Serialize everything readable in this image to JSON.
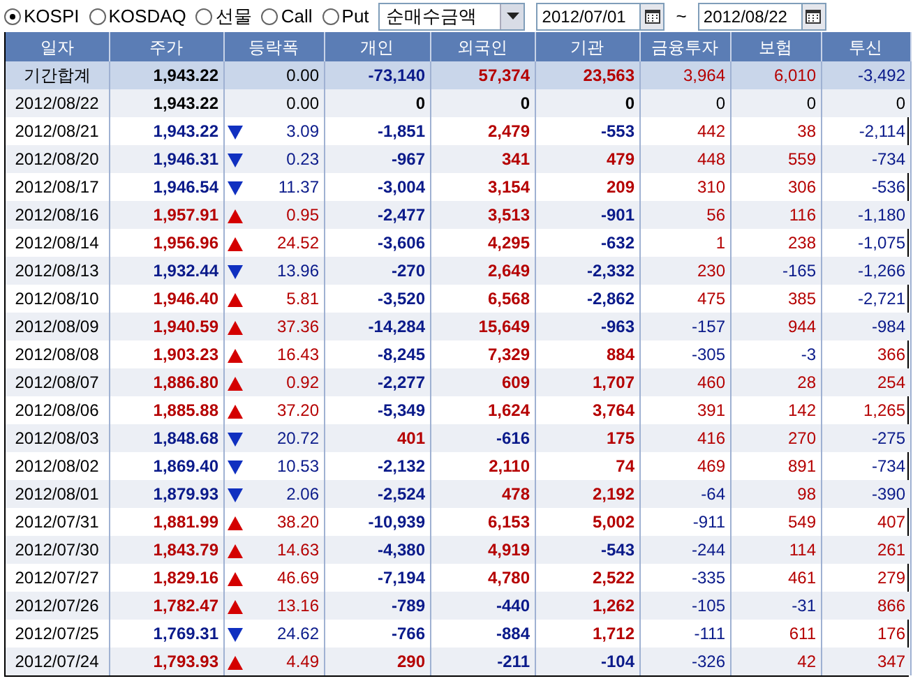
{
  "market_options": [
    {
      "label": "KOSPI",
      "selected": true
    },
    {
      "label": "KOSDAQ",
      "selected": false
    },
    {
      "label": "선물",
      "selected": false
    },
    {
      "label": "Call",
      "selected": false
    },
    {
      "label": "Put",
      "selected": false
    }
  ],
  "metric_select": {
    "value": "순매수금액"
  },
  "date_from": {
    "value": "2012/07/01"
  },
  "range_separator": "~",
  "date_to": {
    "value": "2012/08/22"
  },
  "table": {
    "columns": [
      "일자",
      "주가",
      "등락폭",
      "개인",
      "외국인",
      "기관",
      "금융투자",
      "보험",
      "투신"
    ],
    "rows": [
      {
        "kind": "total",
        "color": "#000000",
        "date": "기간합계",
        "close": "1,943.22",
        "change": "0.00",
        "flows": [
          {
            "value": "-73,140",
            "color": "#0a1a8a"
          },
          {
            "value": "57,374",
            "color": "#b50000"
          },
          {
            "value": "23,563",
            "color": "#b50000"
          },
          {
            "value": "3,964",
            "color": "#b50000"
          },
          {
            "value": "6,010",
            "color": "#b50000"
          },
          {
            "value": "-3,492",
            "color": "#0a1a8a"
          }
        ]
      },
      {
        "kind": "flat",
        "color": "#000000",
        "date": "2012/08/22",
        "close": "1,943.22",
        "change": "0.00",
        "flows": [
          {
            "value": "0",
            "color": "#000000"
          },
          {
            "value": "0",
            "color": "#000000"
          },
          {
            "value": "0",
            "color": "#000000"
          },
          {
            "value": "0",
            "color": "#000000"
          },
          {
            "value": "0",
            "color": "#000000"
          },
          {
            "value": "0",
            "color": "#000000"
          }
        ]
      },
      {
        "kind": "down",
        "color": "#0a1a8a",
        "date": "2012/08/21",
        "close": "1,943.22",
        "change": "3.09",
        "flows": [
          {
            "value": "-1,851",
            "color": "#0a1a8a"
          },
          {
            "value": "2,479",
            "color": "#b50000"
          },
          {
            "value": "-553",
            "color": "#0a1a8a"
          },
          {
            "value": "442",
            "color": "#b50000"
          },
          {
            "value": "38",
            "color": "#b50000"
          },
          {
            "value": "-2,114",
            "color": "#0a1a8a"
          }
        ]
      },
      {
        "kind": "down",
        "color": "#0a1a8a",
        "date": "2012/08/20",
        "close": "1,946.31",
        "change": "0.23",
        "flows": [
          {
            "value": "-967",
            "color": "#0a1a8a"
          },
          {
            "value": "341",
            "color": "#b50000"
          },
          {
            "value": "479",
            "color": "#b50000"
          },
          {
            "value": "448",
            "color": "#b50000"
          },
          {
            "value": "559",
            "color": "#b50000"
          },
          {
            "value": "-734",
            "color": "#0a1a8a"
          }
        ]
      },
      {
        "kind": "down",
        "color": "#0a1a8a",
        "date": "2012/08/17",
        "close": "1,946.54",
        "change": "11.37",
        "flows": [
          {
            "value": "-3,004",
            "color": "#0a1a8a"
          },
          {
            "value": "3,154",
            "color": "#b50000"
          },
          {
            "value": "209",
            "color": "#b50000"
          },
          {
            "value": "310",
            "color": "#b50000"
          },
          {
            "value": "306",
            "color": "#b50000"
          },
          {
            "value": "-536",
            "color": "#0a1a8a"
          }
        ]
      },
      {
        "kind": "up",
        "color": "#b50000",
        "date": "2012/08/16",
        "close": "1,957.91",
        "change": "0.95",
        "flows": [
          {
            "value": "-2,477",
            "color": "#0a1a8a"
          },
          {
            "value": "3,513",
            "color": "#b50000"
          },
          {
            "value": "-901",
            "color": "#0a1a8a"
          },
          {
            "value": "56",
            "color": "#b50000"
          },
          {
            "value": "116",
            "color": "#b50000"
          },
          {
            "value": "-1,180",
            "color": "#0a1a8a"
          }
        ]
      },
      {
        "kind": "up",
        "color": "#b50000",
        "date": "2012/08/14",
        "close": "1,956.96",
        "change": "24.52",
        "flows": [
          {
            "value": "-3,606",
            "color": "#0a1a8a"
          },
          {
            "value": "4,295",
            "color": "#b50000"
          },
          {
            "value": "-632",
            "color": "#0a1a8a"
          },
          {
            "value": "1",
            "color": "#b50000"
          },
          {
            "value": "238",
            "color": "#b50000"
          },
          {
            "value": "-1,075",
            "color": "#0a1a8a"
          }
        ]
      },
      {
        "kind": "down",
        "color": "#0a1a8a",
        "date": "2012/08/13",
        "close": "1,932.44",
        "change": "13.96",
        "flows": [
          {
            "value": "-270",
            "color": "#0a1a8a"
          },
          {
            "value": "2,649",
            "color": "#b50000"
          },
          {
            "value": "-2,332",
            "color": "#0a1a8a"
          },
          {
            "value": "230",
            "color": "#b50000"
          },
          {
            "value": "-165",
            "color": "#0a1a8a"
          },
          {
            "value": "-1,266",
            "color": "#0a1a8a"
          }
        ]
      },
      {
        "kind": "up",
        "color": "#b50000",
        "date": "2012/08/10",
        "close": "1,946.40",
        "change": "5.81",
        "flows": [
          {
            "value": "-3,520",
            "color": "#0a1a8a"
          },
          {
            "value": "6,568",
            "color": "#b50000"
          },
          {
            "value": "-2,862",
            "color": "#0a1a8a"
          },
          {
            "value": "475",
            "color": "#b50000"
          },
          {
            "value": "385",
            "color": "#b50000"
          },
          {
            "value": "-2,721",
            "color": "#0a1a8a"
          }
        ]
      },
      {
        "kind": "up",
        "color": "#b50000",
        "date": "2012/08/09",
        "close": "1,940.59",
        "change": "37.36",
        "flows": [
          {
            "value": "-14,284",
            "color": "#0a1a8a"
          },
          {
            "value": "15,649",
            "color": "#b50000"
          },
          {
            "value": "-963",
            "color": "#0a1a8a"
          },
          {
            "value": "-157",
            "color": "#0a1a8a"
          },
          {
            "value": "944",
            "color": "#b50000"
          },
          {
            "value": "-984",
            "color": "#0a1a8a"
          }
        ]
      },
      {
        "kind": "up",
        "color": "#b50000",
        "date": "2012/08/08",
        "close": "1,903.23",
        "change": "16.43",
        "flows": [
          {
            "value": "-8,245",
            "color": "#0a1a8a"
          },
          {
            "value": "7,329",
            "color": "#b50000"
          },
          {
            "value": "884",
            "color": "#b50000"
          },
          {
            "value": "-305",
            "color": "#0a1a8a"
          },
          {
            "value": "-3",
            "color": "#0a1a8a"
          },
          {
            "value": "366",
            "color": "#b50000"
          }
        ]
      },
      {
        "kind": "up",
        "color": "#b50000",
        "date": "2012/08/07",
        "close": "1,886.80",
        "change": "0.92",
        "flows": [
          {
            "value": "-2,277",
            "color": "#0a1a8a"
          },
          {
            "value": "609",
            "color": "#b50000"
          },
          {
            "value": "1,707",
            "color": "#b50000"
          },
          {
            "value": "460",
            "color": "#b50000"
          },
          {
            "value": "28",
            "color": "#b50000"
          },
          {
            "value": "254",
            "color": "#b50000"
          }
        ]
      },
      {
        "kind": "up",
        "color": "#b50000",
        "date": "2012/08/06",
        "close": "1,885.88",
        "change": "37.20",
        "flows": [
          {
            "value": "-5,349",
            "color": "#0a1a8a"
          },
          {
            "value": "1,624",
            "color": "#b50000"
          },
          {
            "value": "3,764",
            "color": "#b50000"
          },
          {
            "value": "391",
            "color": "#b50000"
          },
          {
            "value": "142",
            "color": "#b50000"
          },
          {
            "value": "1,265",
            "color": "#b50000"
          }
        ]
      },
      {
        "kind": "down",
        "color": "#0a1a8a",
        "date": "2012/08/03",
        "close": "1,848.68",
        "change": "20.72",
        "flows": [
          {
            "value": "401",
            "color": "#b50000"
          },
          {
            "value": "-616",
            "color": "#0a1a8a"
          },
          {
            "value": "175",
            "color": "#b50000"
          },
          {
            "value": "416",
            "color": "#b50000"
          },
          {
            "value": "270",
            "color": "#b50000"
          },
          {
            "value": "-275",
            "color": "#0a1a8a"
          }
        ]
      },
      {
        "kind": "down",
        "color": "#0a1a8a",
        "date": "2012/08/02",
        "close": "1,869.40",
        "change": "10.53",
        "flows": [
          {
            "value": "-2,132",
            "color": "#0a1a8a"
          },
          {
            "value": "2,110",
            "color": "#b50000"
          },
          {
            "value": "74",
            "color": "#b50000"
          },
          {
            "value": "469",
            "color": "#b50000"
          },
          {
            "value": "891",
            "color": "#b50000"
          },
          {
            "value": "-734",
            "color": "#0a1a8a"
          }
        ]
      },
      {
        "kind": "down",
        "color": "#0a1a8a",
        "date": "2012/08/01",
        "close": "1,879.93",
        "change": "2.06",
        "flows": [
          {
            "value": "-2,524",
            "color": "#0a1a8a"
          },
          {
            "value": "478",
            "color": "#b50000"
          },
          {
            "value": "2,192",
            "color": "#b50000"
          },
          {
            "value": "-64",
            "color": "#0a1a8a"
          },
          {
            "value": "98",
            "color": "#b50000"
          },
          {
            "value": "-390",
            "color": "#0a1a8a"
          }
        ]
      },
      {
        "kind": "up",
        "color": "#b50000",
        "date": "2012/07/31",
        "close": "1,881.99",
        "change": "38.20",
        "flows": [
          {
            "value": "-10,939",
            "color": "#0a1a8a"
          },
          {
            "value": "6,153",
            "color": "#b50000"
          },
          {
            "value": "5,002",
            "color": "#b50000"
          },
          {
            "value": "-911",
            "color": "#0a1a8a"
          },
          {
            "value": "549",
            "color": "#b50000"
          },
          {
            "value": "407",
            "color": "#b50000"
          }
        ]
      },
      {
        "kind": "up",
        "color": "#b50000",
        "date": "2012/07/30",
        "close": "1,843.79",
        "change": "14.63",
        "flows": [
          {
            "value": "-4,380",
            "color": "#0a1a8a"
          },
          {
            "value": "4,919",
            "color": "#b50000"
          },
          {
            "value": "-543",
            "color": "#0a1a8a"
          },
          {
            "value": "-244",
            "color": "#0a1a8a"
          },
          {
            "value": "114",
            "color": "#b50000"
          },
          {
            "value": "261",
            "color": "#b50000"
          }
        ]
      },
      {
        "kind": "up",
        "color": "#b50000",
        "date": "2012/07/27",
        "close": "1,829.16",
        "change": "46.69",
        "flows": [
          {
            "value": "-7,194",
            "color": "#0a1a8a"
          },
          {
            "value": "4,780",
            "color": "#b50000"
          },
          {
            "value": "2,522",
            "color": "#b50000"
          },
          {
            "value": "-335",
            "color": "#0a1a8a"
          },
          {
            "value": "461",
            "color": "#b50000"
          },
          {
            "value": "279",
            "color": "#b50000"
          }
        ]
      },
      {
        "kind": "up",
        "color": "#b50000",
        "date": "2012/07/26",
        "close": "1,782.47",
        "change": "13.16",
        "flows": [
          {
            "value": "-789",
            "color": "#0a1a8a"
          },
          {
            "value": "-440",
            "color": "#0a1a8a"
          },
          {
            "value": "1,262",
            "color": "#b50000"
          },
          {
            "value": "-105",
            "color": "#0a1a8a"
          },
          {
            "value": "-31",
            "color": "#0a1a8a"
          },
          {
            "value": "866",
            "color": "#b50000"
          }
        ]
      },
      {
        "kind": "down",
        "color": "#0a1a8a",
        "date": "2012/07/25",
        "close": "1,769.31",
        "change": "24.62",
        "flows": [
          {
            "value": "-766",
            "color": "#0a1a8a"
          },
          {
            "value": "-884",
            "color": "#0a1a8a"
          },
          {
            "value": "1,712",
            "color": "#b50000"
          },
          {
            "value": "-111",
            "color": "#0a1a8a"
          },
          {
            "value": "611",
            "color": "#b50000"
          },
          {
            "value": "176",
            "color": "#b50000"
          }
        ]
      },
      {
        "kind": "up",
        "color": "#b50000",
        "date": "2012/07/24",
        "close": "1,793.93",
        "change": "4.49",
        "flows": [
          {
            "value": "290",
            "color": "#b50000"
          },
          {
            "value": "-211",
            "color": "#0a1a8a"
          },
          {
            "value": "-104",
            "color": "#0a1a8a"
          },
          {
            "value": "-326",
            "color": "#0a1a8a"
          },
          {
            "value": "42",
            "color": "#b50000"
          },
          {
            "value": "347",
            "color": "#b50000"
          }
        ]
      }
    ]
  }
}
